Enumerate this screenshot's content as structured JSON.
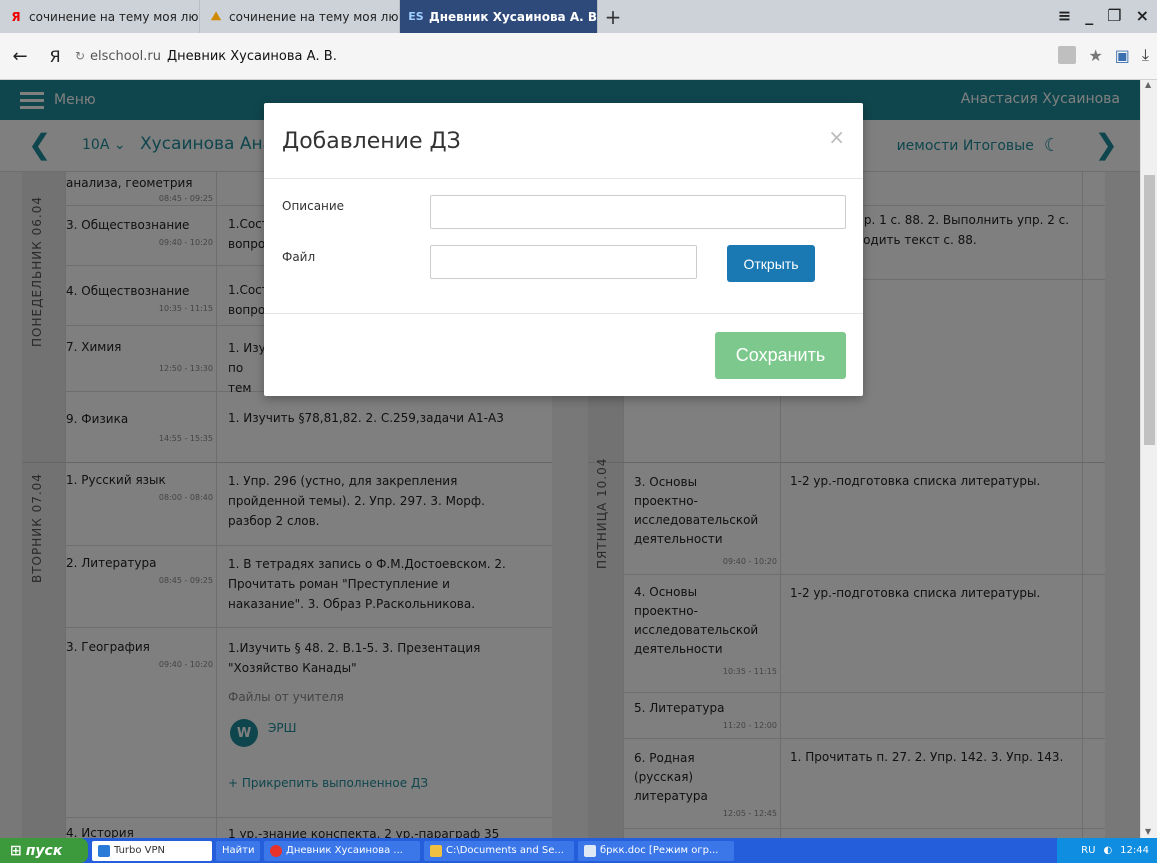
{
  "tabs": [
    {
      "icon": "Я",
      "label": "сочинение на тему моя люб",
      "active": false
    },
    {
      "icon": "⛰",
      "label": "сочинение на тему моя люб",
      "active": false
    },
    {
      "icon": "ES",
      "label": "Дневник Хусаинова А. В",
      "active": true
    }
  ],
  "address": {
    "domain": "elschool.ru",
    "title": "Дневник Хусаинова А. В."
  },
  "site": {
    "menu_label": "Меню",
    "username": "Анастасия Хусаинова",
    "class_selector": "10А",
    "student_name": "Хусаинова Анас",
    "links_right": "иемости  Итоговые"
  },
  "monday": {
    "label": "ПОНЕДЕЛЬНИК  06.04",
    "lessons": [
      {
        "name": "анализа, геометрия",
        "time": "08:45 - 09:25",
        "hw": ""
      },
      {
        "name": "3. Обществознание",
        "time": "09:40 - 10:20",
        "hw": "1.Сост вопро"
      },
      {
        "name": "4. Обществознание",
        "time": "10:35 - 11:15",
        "hw": "1.Сост вопро"
      },
      {
        "name": "7. Химия",
        "time": "12:50 - 13:30",
        "hw": "1. Изу по тем"
      },
      {
        "name": "9. Физика",
        "time": "14:55 - 15:35",
        "hw": "1. Изучить §78,81,82. 2. С.259,задачи А1-А3"
      }
    ]
  },
  "thursday_partial": {
    "hw1": "пр. 1 с. 88. 2. Выполнить упр. 2 с.",
    "hw2": "водить текст с. 88."
  },
  "tuesday": {
    "label": "ВТОРНИК  07.04",
    "lessons": [
      {
        "name": "1. Русский язык",
        "time": "08:00 - 08:40",
        "hw": "1. Упр. 296 (устно, для закрепления пройденной темы). 2. Упр. 297. 3. Морф. разбор 2 слов."
      },
      {
        "name": "2. Литература",
        "time": "08:45 - 09:25",
        "hw": "1. В тетрадях запись о Ф.М.Достоевском. 2. Прочитать роман \"Преступление и наказание\". 3. Образ Р.Раскольникова."
      },
      {
        "name": "3. География",
        "time": "09:40 - 10:20",
        "hw": "1.Изучить § 48. 2. В.1-5. 3. Презентация \"Хозяйство Канады\""
      },
      {
        "name": "4. История",
        "time": "",
        "hw": "1 ур.-знание конспекта. 2 ур.-параграф 35"
      }
    ],
    "files_title": "Файлы от учителя",
    "file_name": "ЭРШ",
    "attach_label": "+ Прикрепить выполненное ДЗ"
  },
  "friday": {
    "label": "ПЯТНИЦА  10.04",
    "lessons": [
      {
        "name": "3. Основы проектно-исследовательской деятельности",
        "time": "09:40 - 10:20",
        "hw": "1-2 ур.-подготовка списка литературы."
      },
      {
        "name": "4. Основы проектно-исследовательской деятельности",
        "time": "10:35 - 11:15",
        "hw": "1-2 ур.-подготовка списка литературы."
      },
      {
        "name": "5. Литература",
        "time": "11:20 - 12:00",
        "hw": ""
      },
      {
        "name": "6. Родная (русская) литература",
        "time": "12:05 - 12:45",
        "hw": "1. Прочитать п. 27. 2. Упр. 142. 3. Упр. 143."
      }
    ]
  },
  "modal": {
    "title": "Добавление ДЗ",
    "close": "×",
    "desc_label": "Описание",
    "desc_value": "",
    "file_label": "Файл",
    "file_value": "",
    "open_button": "Открыть",
    "save_button": "Сохранить"
  },
  "taskbar": {
    "start": "пуск",
    "items": [
      "Turbo VPN",
      "Найти",
      "Дневник Хусаинова ...",
      "C:\\Documents and Se...",
      "бркк.doc [Режим огр..."
    ],
    "lang": "RU",
    "time": "12:44"
  }
}
